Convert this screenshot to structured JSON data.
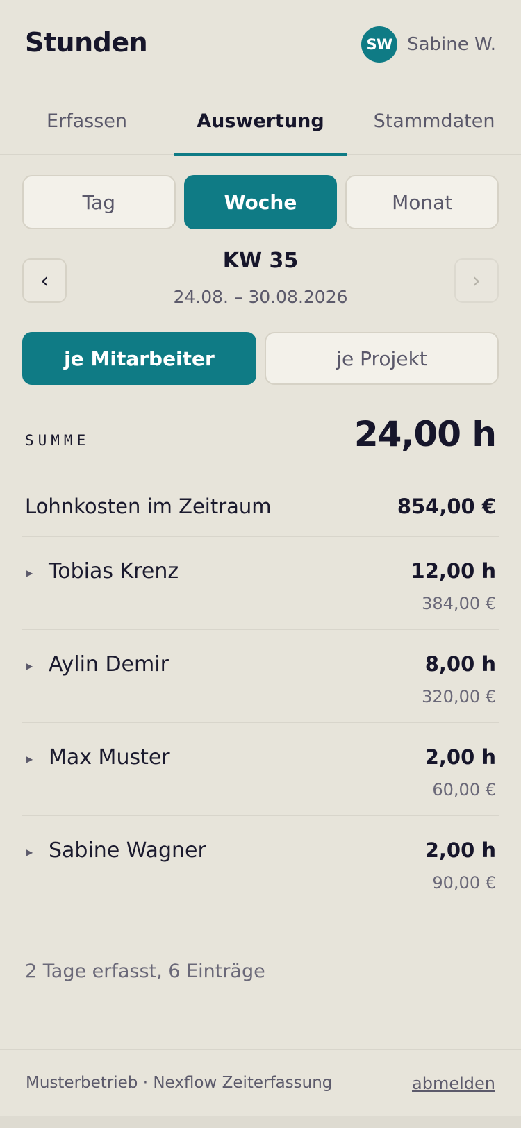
{
  "header": {
    "title": "Stunden",
    "user_initials": "SW",
    "user_name": "Sabine W."
  },
  "tabs": [
    {
      "label": "Erfassen",
      "active": false
    },
    {
      "label": "Auswertung",
      "active": true
    },
    {
      "label": "Stammdaten",
      "active": false
    }
  ],
  "period": {
    "options": [
      "Tag",
      "Woche",
      "Monat"
    ],
    "selected": "Woche"
  },
  "week": {
    "prev_label": "‹",
    "next_label": "›",
    "title": "KW 35",
    "range": "24.08. – 30.08.2026"
  },
  "grouping": {
    "options": [
      "je Mitarbeiter",
      "je Projekt"
    ],
    "selected": "je Mitarbeiter"
  },
  "summary": {
    "label": "SUMME",
    "value": "24,00 h",
    "cost_label": "Lohnkosten im Zeitraum",
    "cost_value": "854,00 €"
  },
  "employees": [
    {
      "name": "Tobias Krenz",
      "hours": "12,00 h",
      "cost": "384,00 €"
    },
    {
      "name": "Aylin Demir",
      "hours": "8,00 h",
      "cost": "320,00 €"
    },
    {
      "name": "Max Muster",
      "hours": "2,00 h",
      "cost": "60,00 €"
    },
    {
      "name": "Sabine Wagner",
      "hours": "2,00 h",
      "cost": "90,00 €"
    }
  ],
  "entries_note": "2 Tage erfasst, 6 Einträge",
  "footer": {
    "brand": "Musterbetrieb · Nexflow Zeiterfassung",
    "logout": "abmelden"
  },
  "colors": {
    "accent": "#0f7b85",
    "background": "#e7e4da",
    "text": "#17162b"
  },
  "icons": {
    "expand": "triangle-right-icon"
  }
}
